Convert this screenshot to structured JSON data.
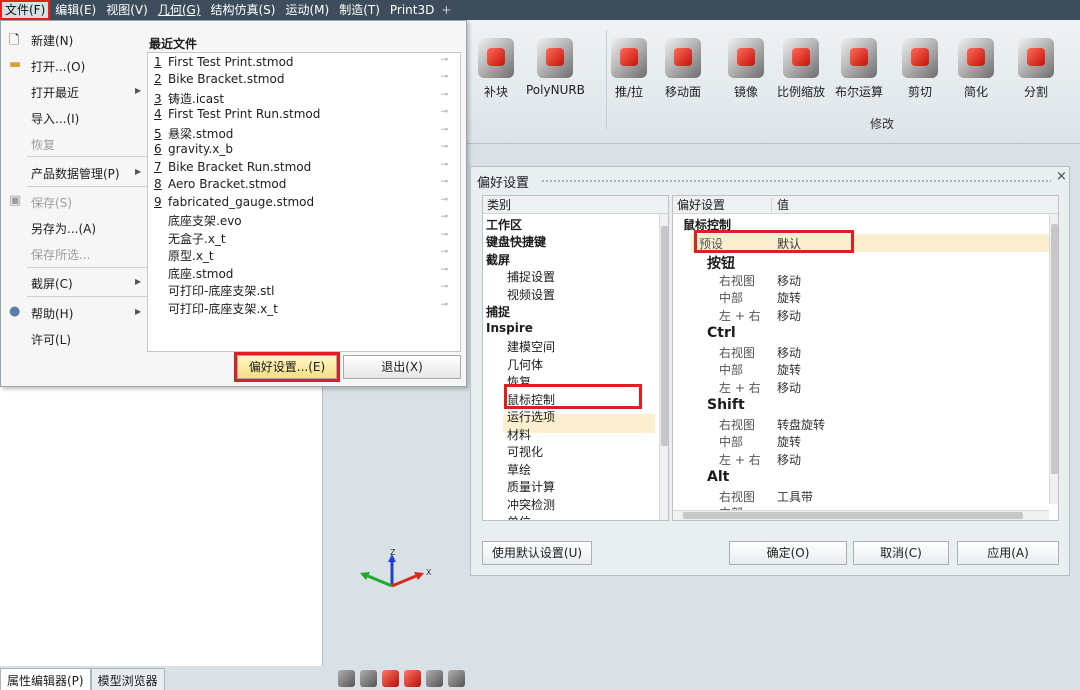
{
  "menubar": {
    "items": [
      "文件(F)",
      "编辑(E)",
      "视图(V)",
      "几何(G)",
      "结构仿真(S)",
      "运动(M)",
      "制造(T)",
      "Print3D"
    ],
    "plus": "+"
  },
  "ribbon": {
    "tools": [
      {
        "label": "补块"
      },
      {
        "label": "PolyNURB"
      },
      {
        "label": "推/拉"
      },
      {
        "label": "移动面"
      },
      {
        "label": "镜像"
      },
      {
        "label": "比例缩放"
      },
      {
        "label": "布尔运算"
      },
      {
        "label": "剪切"
      },
      {
        "label": "简化"
      },
      {
        "label": "分割"
      }
    ],
    "group_label": "修改"
  },
  "file_menu": {
    "items": [
      {
        "label": "新建(N)",
        "icon": "new-file-icon"
      },
      {
        "label": "打开...(O)",
        "icon": "folder-icon"
      },
      {
        "label": "打开最近",
        "submenu": true
      },
      {
        "label": "导入...(I)"
      },
      {
        "label": "恢复",
        "disabled": true
      },
      {
        "label": "产品数据管理(P)",
        "submenu": true
      },
      {
        "label": "保存(S)",
        "disabled": true,
        "icon": "save-icon"
      },
      {
        "label": "另存为...(A)"
      },
      {
        "label": "保存所选...",
        "disabled": true
      },
      {
        "label": "截屏(C)",
        "submenu": true
      },
      {
        "label": "帮助(H)",
        "submenu": true,
        "icon": "help-icon"
      },
      {
        "label": "许可(L)"
      }
    ],
    "recent_title": "最近文件",
    "recent_files": [
      {
        "num": "1",
        "name": "First Test Print.stmod"
      },
      {
        "num": "2",
        "name": "Bike Bracket.stmod"
      },
      {
        "num": "3",
        "name": "铸造.icast"
      },
      {
        "num": "4",
        "name": "First Test Print Run.stmod"
      },
      {
        "num": "5",
        "name": "悬梁.stmod"
      },
      {
        "num": "6",
        "name": "gravity.x_b"
      },
      {
        "num": "7",
        "name": "Bike Bracket Run.stmod"
      },
      {
        "num": "8",
        "name": "Aero Bracket.stmod"
      },
      {
        "num": "9",
        "name": "fabricated_gauge.stmod"
      },
      {
        "num": "",
        "name": "底座支架.evo"
      },
      {
        "num": "",
        "name": "无盒子.x_t"
      },
      {
        "num": "",
        "name": "原型.x_t"
      },
      {
        "num": "",
        "name": "底座.stmod"
      },
      {
        "num": "",
        "name": "可打印-底座支架.stl"
      },
      {
        "num": "",
        "name": "可打印-底座支架.x_t"
      }
    ],
    "preferences_button": "偏好设置...(E)",
    "exit_button": "退出(X)"
  },
  "preferences": {
    "title": "偏好设置",
    "close": "×",
    "category_header": "类别",
    "categories": [
      {
        "label": "工作区",
        "level": 0
      },
      {
        "label": "键盘快捷键",
        "level": 0
      },
      {
        "label": "截屏",
        "level": 0
      },
      {
        "label": "捕捉设置",
        "level": 1
      },
      {
        "label": "视频设置",
        "level": 1
      },
      {
        "label": "捕捉",
        "level": 0
      },
      {
        "label": "Inspire",
        "level": 0
      },
      {
        "label": "建模空间",
        "level": 1
      },
      {
        "label": "几何体",
        "level": 1
      },
      {
        "label": "恢复",
        "level": 1
      },
      {
        "label": "鼠标控制",
        "level": 1,
        "selected": true
      },
      {
        "label": "运行选项",
        "level": 1
      },
      {
        "label": "材料",
        "level": 1
      },
      {
        "label": "可视化",
        "level": 1
      },
      {
        "label": "草绘",
        "level": 1
      },
      {
        "label": "质量计算",
        "level": 1
      },
      {
        "label": "冲突检测",
        "level": 1
      },
      {
        "label": "单位",
        "level": 1
      }
    ],
    "settings_header": "偏好设置",
    "value_header": "值",
    "group": "鼠标控制",
    "preset": {
      "label": "预设",
      "value": "默认"
    },
    "sections": [
      {
        "name": "按钮",
        "rows": [
          [
            "右视图",
            "移动"
          ],
          [
            "中部",
            "旋转"
          ],
          [
            "左 + 右",
            "移动"
          ]
        ]
      },
      {
        "name": "Ctrl",
        "rows": [
          [
            "右视图",
            "移动"
          ],
          [
            "中部",
            "旋转"
          ],
          [
            "左 + 右",
            "移动"
          ]
        ]
      },
      {
        "name": "Shift",
        "rows": [
          [
            "右视图",
            "转盘旋转"
          ],
          [
            "中部",
            "旋转"
          ],
          [
            "左 + 右",
            "移动"
          ]
        ]
      },
      {
        "name": "Alt",
        "rows": [
          [
            "右视图",
            "工具带"
          ],
          [
            "中部",
            ""
          ]
        ]
      }
    ],
    "buttons": {
      "defaults": "使用默认设置(U)",
      "ok": "确定(O)",
      "cancel": "取消(C)",
      "apply": "应用(A)"
    }
  },
  "bottom_tabs": [
    "属性编辑器(P)",
    "模型浏览器"
  ],
  "axis_labels": {
    "z": "Z",
    "x": "X"
  },
  "colors": {
    "highlight_red": "#dc1f1f",
    "menubar_bg": "#3d4d5c",
    "selected_row": "#fbefd0"
  }
}
